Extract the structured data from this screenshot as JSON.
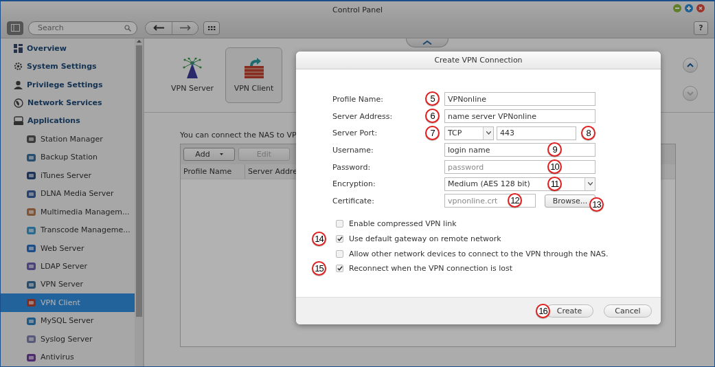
{
  "window": {
    "title": "Control Panel",
    "help": "?"
  },
  "search": {
    "placeholder": "Search"
  },
  "sidebar": {
    "items": [
      {
        "label": "Overview",
        "selected": false
      },
      {
        "label": "System Settings",
        "selected": false
      },
      {
        "label": "Privilege Settings",
        "selected": false
      },
      {
        "label": "Network Services",
        "selected": false
      },
      {
        "label": "Applications",
        "selected": false,
        "children": [
          {
            "label": "Station Manager",
            "selected": false
          },
          {
            "label": "Backup Station",
            "selected": false
          },
          {
            "label": "iTunes Server",
            "selected": false
          },
          {
            "label": "DLNA Media Server",
            "selected": false
          },
          {
            "label": "Multimedia Managem...",
            "selected": false
          },
          {
            "label": "Transcode Manageme...",
            "selected": false
          },
          {
            "label": "Web Server",
            "selected": false
          },
          {
            "label": "LDAP Server",
            "selected": false
          },
          {
            "label": "VPN Server",
            "selected": false
          },
          {
            "label": "VPN Client",
            "selected": true
          },
          {
            "label": "MySQL Server",
            "selected": false
          },
          {
            "label": "Syslog Server",
            "selected": false
          },
          {
            "label": "Antivirus",
            "selected": false
          }
        ]
      }
    ]
  },
  "app_tabs": [
    {
      "label": "VPN Server",
      "selected": false
    },
    {
      "label": "VPN Client",
      "selected": true
    }
  ],
  "intro": "You can connect the NAS to VP",
  "toolbar": [
    {
      "label": "Add",
      "disabled": false,
      "dropdown": true
    },
    {
      "label": "Edit",
      "disabled": true,
      "dropdown": false
    }
  ],
  "table": {
    "columns": [
      "Profile Name",
      "Server Addre"
    ]
  },
  "dialog": {
    "title": "Create VPN Connection",
    "fields": [
      {
        "kind": "text",
        "label": "Profile Name:",
        "value": "VPNonline",
        "callout_before": "5"
      },
      {
        "kind": "text",
        "label": "Server Address:",
        "value": "name server VPNonline",
        "callout_before": "6"
      },
      {
        "kind": "port",
        "label": "Server Port:",
        "protocol": "TCP",
        "callout_before": "7",
        "value": "443",
        "callout": "8"
      },
      {
        "kind": "text",
        "label": "Username:",
        "value": "login name",
        "callout": "9"
      },
      {
        "kind": "text",
        "label": "Password:",
        "placeholder": "password",
        "callout": "10"
      },
      {
        "kind": "select",
        "label": "Encryption:",
        "value": "Medium (AES 128 bit)",
        "callout": "11"
      },
      {
        "kind": "file",
        "label": "Certificate:",
        "placeholder": "vpnonline.crt",
        "button": "Browse...",
        "callout": "12",
        "button_callout": "13"
      }
    ],
    "options": [
      {
        "label": "Enable compressed VPN link",
        "checked": false
      },
      {
        "label": "Use default gateway on remote network",
        "checked": true,
        "callout": "14"
      },
      {
        "label": "Allow other network devices to connect to the VPN through the NAS.",
        "checked": false
      },
      {
        "label": "Reconnect when the VPN connection is lost",
        "checked": true,
        "callout": "15"
      }
    ],
    "buttons": [
      {
        "label": "Create",
        "callout": "16"
      },
      {
        "label": "Cancel"
      }
    ]
  }
}
